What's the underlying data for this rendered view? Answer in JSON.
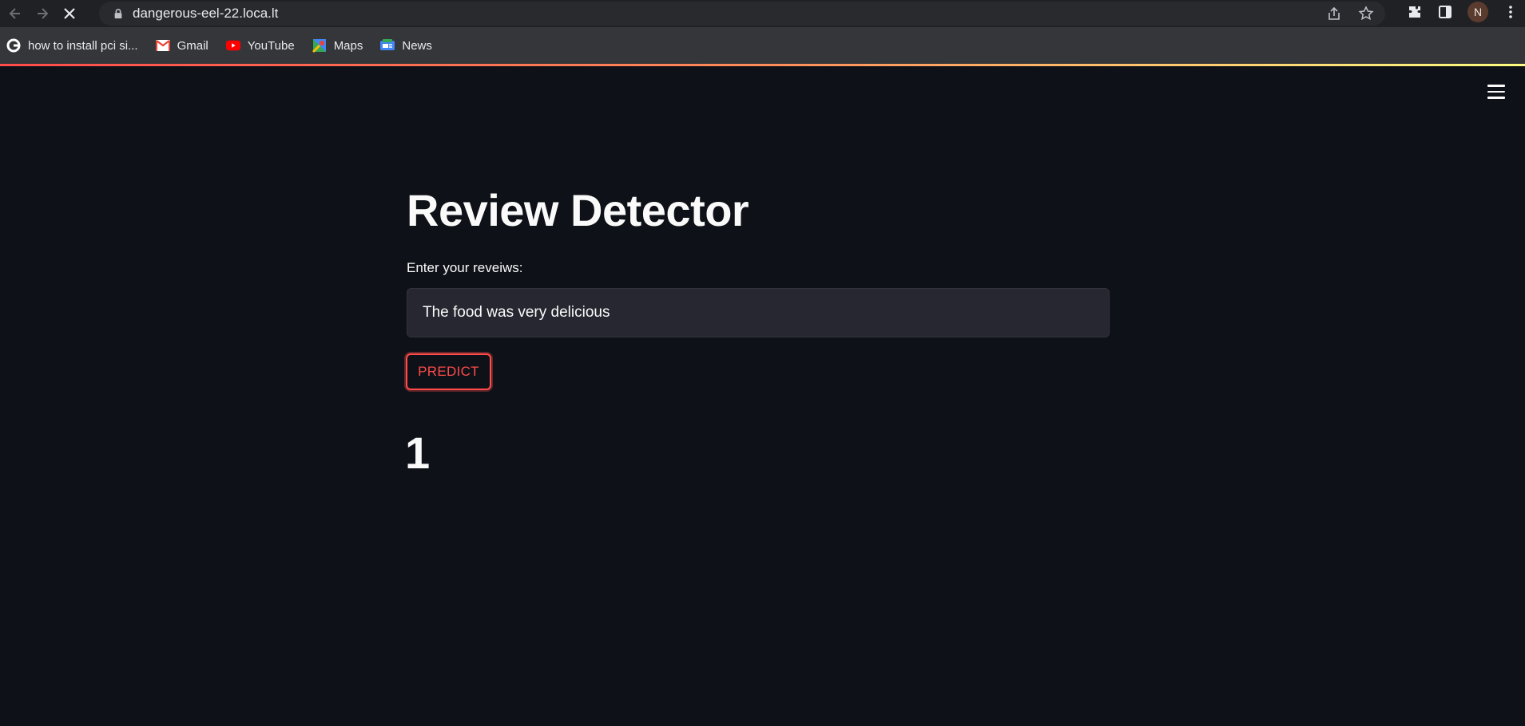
{
  "browser": {
    "url": "dangerous-eel-22.loca.lt",
    "profile_initial": "N",
    "bookmarks": [
      {
        "label": "how to install pci si...",
        "icon": "google-icon"
      },
      {
        "label": "Gmail",
        "icon": "gmail-icon"
      },
      {
        "label": "YouTube",
        "icon": "youtube-icon"
      },
      {
        "label": "Maps",
        "icon": "maps-icon"
      },
      {
        "label": "News",
        "icon": "news-icon"
      }
    ]
  },
  "app": {
    "title": "Review Detector",
    "input_label": "Enter your reveiws:",
    "input_value": "The food was very delicious",
    "button_label": "PREDICT",
    "result": "1"
  },
  "colors": {
    "background": "#0e1117",
    "accent": "#ff4b4b",
    "input_bg": "#262730"
  }
}
